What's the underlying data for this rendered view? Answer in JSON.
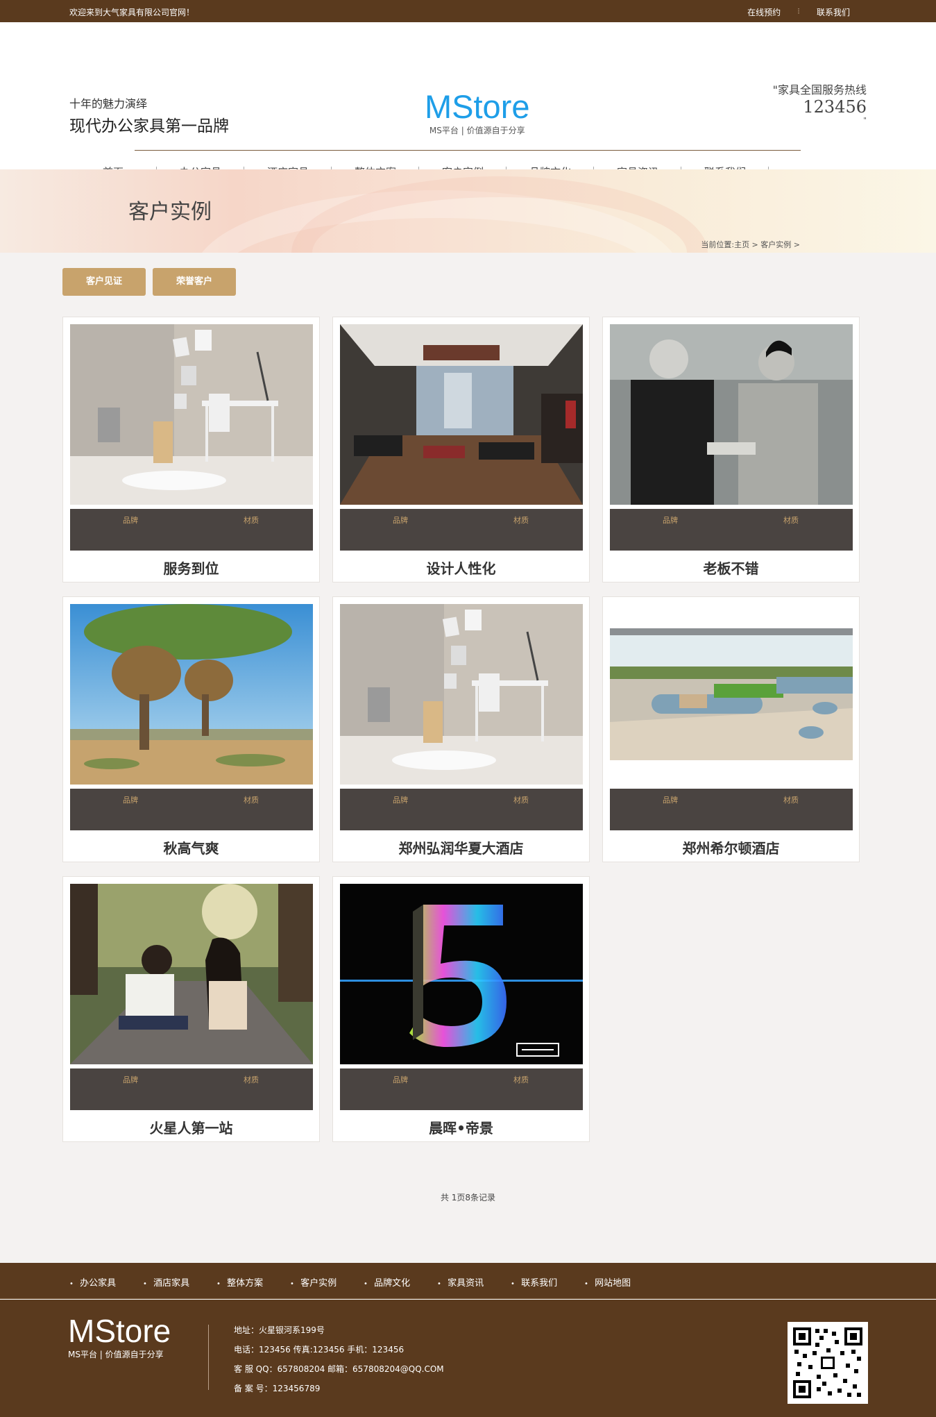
{
  "topbar": {
    "welcome": "欢迎来到大气家具有限公司官网！",
    "links": [
      "在线预约",
      "联系我们"
    ]
  },
  "header": {
    "slogan_line1": "十年的魅力演绎",
    "slogan_line2": "现代办公家具第一品牌",
    "logo_name": "MStore",
    "logo_sub": "MS平台 | 价值源自于分享",
    "hotline_title": "\"家具全国服务热线",
    "hotline_number": "123456",
    "hotline_tail": "\""
  },
  "nav": {
    "items": [
      "首页",
      "办公家具",
      "酒店家具",
      "整体方案",
      "客户实例",
      "品牌文化",
      "家具资讯",
      "联系我们"
    ]
  },
  "banner": {
    "title": "客户实例",
    "crumb": "当前位置:主页 > 客户实例 >"
  },
  "tabs": [
    "客户见证",
    "荣誉客户"
  ],
  "cards": [
    {
      "title": "服务到位",
      "brand": "品牌",
      "material": "材质",
      "image": "office-desk-photo"
    },
    {
      "title": "设计人性化",
      "brand": "品牌",
      "material": "材质",
      "image": "office-room-photo"
    },
    {
      "title": "老板不错",
      "brand": "品牌",
      "material": "材质",
      "image": "handshake-photo"
    },
    {
      "title": "秋高气爽",
      "brand": "品牌",
      "material": "材质",
      "image": "tree-photo"
    },
    {
      "title": "郑州弘润华夏大酒店",
      "brand": "品牌",
      "material": "材质",
      "image": "office-desk-photo"
    },
    {
      "title": "郑州希尔顿酒店",
      "brand": "品牌",
      "material": "材质",
      "image": "lounge-photo"
    },
    {
      "title": "火星人第一站",
      "brand": "品牌",
      "material": "材质",
      "image": "couple-photo"
    },
    {
      "title": "晨晖•帝景",
      "brand": "品牌",
      "material": "材质",
      "image": "number-five-photo"
    }
  ],
  "pager": {
    "text": "共 1页8条记录"
  },
  "footer_nav": [
    "办公家具",
    "酒店家具",
    "整体方案",
    "客户实例",
    "品牌文化",
    "家具资讯",
    "联系我们",
    "网站地图"
  ],
  "footer": {
    "logo_name": "MStore",
    "logo_sub": "MS平台 | 价值源自于分享",
    "address": "地址：火星银河系199号",
    "phones": "电话：123456    传真:123456    手机：123456",
    "qq": "客 服 QQ：657808204      邮箱：657808204@QQ.COM",
    "record": "备 案 号：123456789"
  }
}
